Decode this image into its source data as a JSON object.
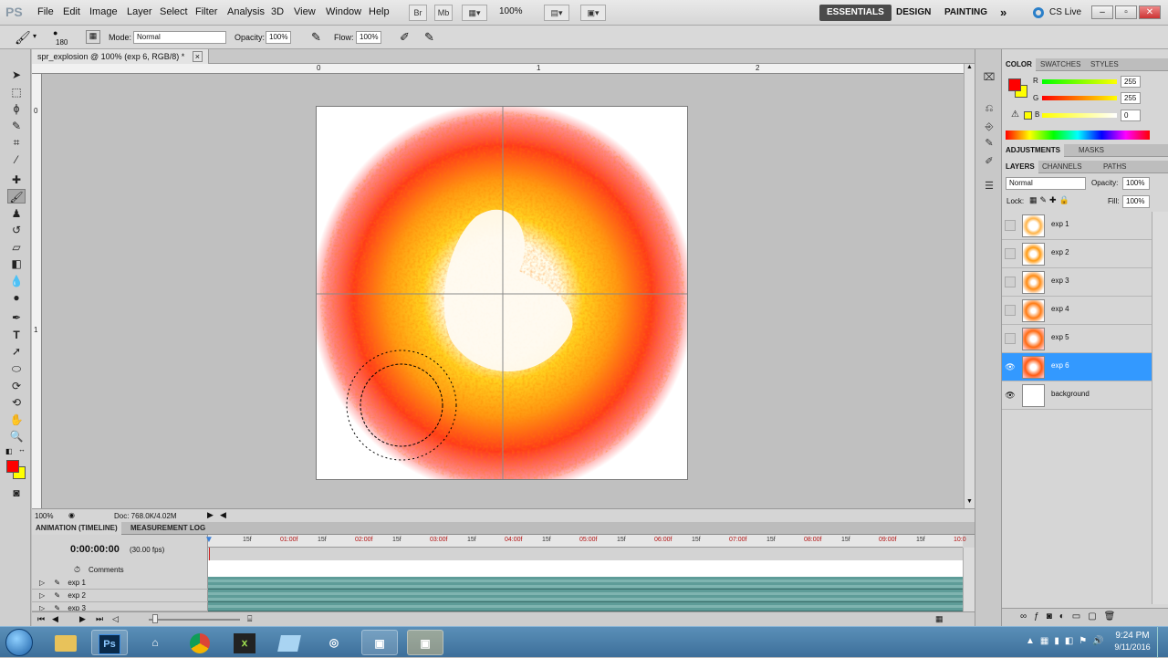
{
  "app": {
    "logo": "PS"
  },
  "menu": [
    "File",
    "Edit",
    "Image",
    "Layer",
    "Select",
    "Filter",
    "Analysis",
    "3D",
    "View",
    "Window",
    "Help"
  ],
  "menubar_extra": {
    "br": "Br",
    "mb": "Mb",
    "zoom": "100%"
  },
  "workspaces": {
    "essentials": "ESSENTIALS",
    "design": "DESIGN",
    "painting": "PAINTING",
    "more": "»",
    "cslive": "CS Live"
  },
  "options": {
    "brush_size": "180",
    "mode_label": "Mode:",
    "mode_value": "Normal",
    "opacity_label": "Opacity:",
    "opacity_value": "100%",
    "flow_label": "Flow:",
    "flow_value": "100%"
  },
  "document": {
    "tab_title": "spr_explosion @ 100% (exp 6, RGB/8) *",
    "ruler_h": [
      "0",
      "1",
      "2"
    ],
    "ruler_v": [
      "0",
      "1"
    ]
  },
  "status": {
    "zoom": "100%",
    "doc": "Doc: 768.0K/4.02M"
  },
  "animation": {
    "tabs": [
      "ANIMATION (TIMELINE)",
      "MEASUREMENT LOG"
    ],
    "time": "0:00:00:00",
    "fps": "(30.00 fps)",
    "comments": "Comments",
    "ticks": [
      "15f",
      "01:00f",
      "15f",
      "02:00f",
      "15f",
      "03:00f",
      "15f",
      "04:00f",
      "15f",
      "05:00f",
      "15f",
      "06:00f",
      "15f",
      "07:00f",
      "15f",
      "08:00f",
      "15f",
      "09:00f",
      "15f",
      "10:0"
    ],
    "layers": [
      "exp 1",
      "exp 2",
      "exp 3"
    ]
  },
  "panels": {
    "color_tabs": [
      "COLOR",
      "SWATCHES",
      "STYLES"
    ],
    "rgb": [
      {
        "label": "R",
        "value": "255"
      },
      {
        "label": "G",
        "value": "255"
      },
      {
        "label": "B",
        "value": "0"
      }
    ],
    "adj_tabs": [
      "ADJUSTMENTS",
      "MASKS"
    ],
    "layer_tabs": [
      "LAYERS",
      "CHANNELS",
      "PATHS"
    ],
    "blend": "Normal",
    "opacity_label": "Opacity:",
    "opacity": "100%",
    "lock_label": "Lock:",
    "fill_label": "Fill:",
    "fill": "100%",
    "layers": [
      {
        "name": "exp 1",
        "visible": false,
        "selected": false
      },
      {
        "name": "exp 2",
        "visible": false,
        "selected": false
      },
      {
        "name": "exp 3",
        "visible": false,
        "selected": false
      },
      {
        "name": "exp 4",
        "visible": false,
        "selected": false
      },
      {
        "name": "exp 5",
        "visible": false,
        "selected": false
      },
      {
        "name": "exp 6",
        "visible": true,
        "selected": true
      },
      {
        "name": "background",
        "visible": true,
        "selected": false
      }
    ]
  },
  "taskbar": {
    "ps": "Ps",
    "time": "9:24 PM",
    "date": "9/11/2016"
  },
  "colors": {
    "fg": "#ff0000",
    "bg": "#ffff00",
    "accent": "#3399ff"
  }
}
